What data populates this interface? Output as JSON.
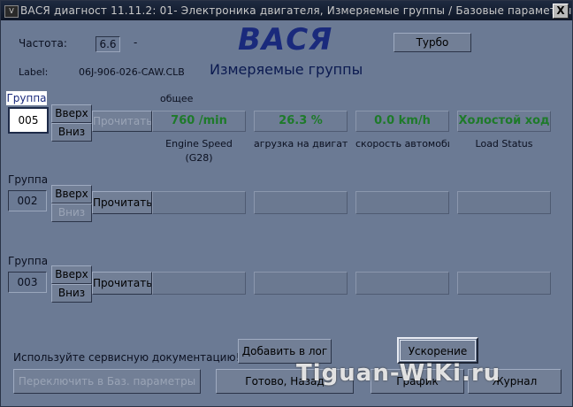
{
  "window": {
    "title": "ВАСЯ диагност 11.11.2: 01- Электроника двигателя, Измеряемые группы / Базовые параметры",
    "close_label": "X",
    "app_icon_label": "V"
  },
  "header": {
    "freq_label": "Частота:",
    "freq_value": "6.6",
    "freq_suffix": "-",
    "label_label": "Label:",
    "label_value": "06J-906-026-CAW.CLB",
    "logo": "ВАСЯ",
    "subtitle": "Измеряемые группы",
    "turbo_button": "Турбо"
  },
  "groups": [
    {
      "group_label": "Группа",
      "number": "005",
      "up_label": "Вверх",
      "down_label": "Вниз",
      "read_label": "Прочитать",
      "header_text": "общее",
      "values": [
        "760 /min",
        "26.3 %",
        "0.0 km/h",
        "Холостой ход"
      ],
      "descs": [
        "Engine Speed",
        "агрузка на двигатель",
        "скорость автомобиля",
        "Load Status"
      ],
      "desc2": [
        "(G28)",
        "",
        "",
        ""
      ]
    },
    {
      "group_label": "Группа",
      "number": "002",
      "up_label": "Вверх",
      "down_label": "Вниз",
      "read_label": "Прочитать",
      "values": [
        "",
        "",
        "",
        ""
      ]
    },
    {
      "group_label": "Группа",
      "number": "003",
      "up_label": "Вверх",
      "down_label": "Вниз",
      "read_label": "Прочитать",
      "values": [
        "",
        "",
        "",
        ""
      ]
    }
  ],
  "footer": {
    "doc_hint": "Используйте сервисную документацию!",
    "add_log": "Добавить в лог",
    "accel": "Ускорение",
    "switch_basic": "Переключить в Баз. параметры",
    "done_back": "Готово, Назад",
    "graph": "График",
    "log": "Журнал"
  },
  "watermark": "Tiguan-WiKi.ru",
  "colors": {
    "window_bg": "#6b7a94",
    "value_text": "#1e7a2a",
    "logo": "#1a2a7c",
    "titlebar": "#0e1626"
  }
}
